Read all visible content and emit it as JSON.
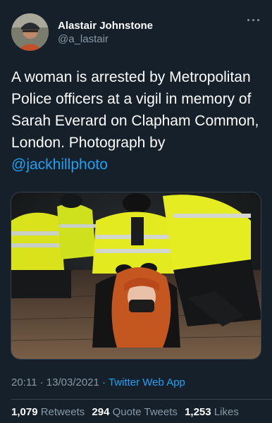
{
  "author": {
    "name": "Alastair Johnstone",
    "handle": "@a_lastair"
  },
  "tweet": {
    "text_before": "A woman is arrested by Metropolitan Police officers at a vigil in memory of Sarah Everard on Clapham Common, London. Photograph by ",
    "mention": "@jackhillphoto"
  },
  "photo": {
    "description_icon": "photo"
  },
  "meta": {
    "time": "20:11",
    "date": "13/03/2021",
    "separator": "·",
    "app": "Twitter Web App"
  },
  "stats": {
    "retweets_count": "1,079",
    "retweets_label": "Retweets",
    "quotes_count": "294",
    "quotes_label": "Quote Tweets",
    "likes_count": "1,253",
    "likes_label": "Likes"
  },
  "colors": {
    "background": "#15202b",
    "link": "#1da1f2",
    "muted": "#8899a6"
  }
}
